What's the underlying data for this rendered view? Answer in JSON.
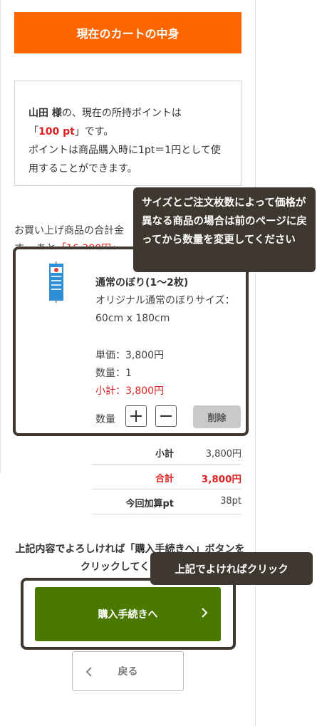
{
  "cart": {
    "title": "現在のカートの中身"
  },
  "points": {
    "user_name": "山田 様",
    "line1_suffix": "の、現在の所持ポイントは",
    "open_quote": "「",
    "points_value": "100 pt",
    "close_quote": "」です。",
    "note": "ポイントは商品購入時に1pt＝1円として使用することができます。"
  },
  "notice": {
    "text_a": "お買い上げ商品の合計金",
    "text_b": "す。 あと",
    "remaining": "「16,200円」"
  },
  "tooltips": {
    "size_change": "サイズとご注文枚数によって価格が異なる商品の場合は前のページに戻ってから数量を変更してください",
    "proceed_hint": "上記でよければクリック"
  },
  "item": {
    "name": "通常のぼり(1〜2枚)",
    "description": "オリジナル通常のぼりサイズ：60cm x 180cm",
    "unit_price": "単価：3,800円",
    "quantity": "数量：1",
    "subtotal": "小計：3,800円",
    "qty_label": "数量",
    "delete_label": "削除",
    "plus_icon": "plus-icon",
    "minus_icon": "minus-icon"
  },
  "summary": {
    "subtotal_label": "小計",
    "subtotal_value": "3,800円",
    "total_label": "合計",
    "total_value": "3,800円",
    "points_label": "今回加算pt",
    "points_value": "38pt"
  },
  "proceed": {
    "message": "上記内容でよろしければ「購入手続きへ」ボタンをクリックしてください",
    "button_label": "購入手続きへ",
    "back_label": "戻る"
  },
  "colors": {
    "accent": "#ff6600",
    "primary_button": "#4a7800",
    "price_red": "#e02020",
    "tooltip_bg": "#3e3830"
  }
}
